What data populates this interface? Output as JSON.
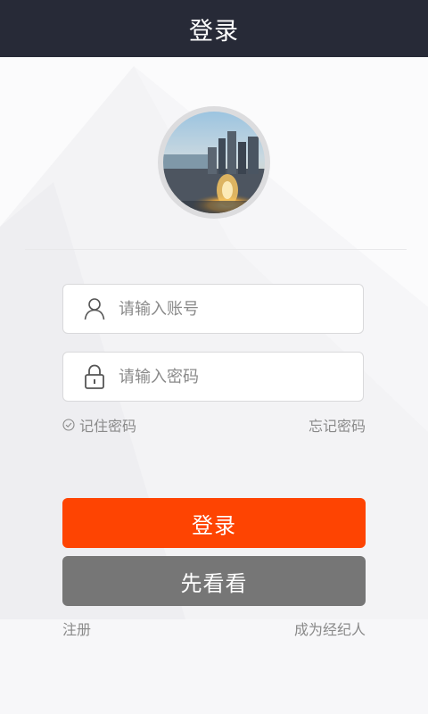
{
  "header": {
    "title": "登录"
  },
  "form": {
    "account_placeholder": "请输入账号",
    "password_placeholder": "请输入密码",
    "remember_label": "记住密码",
    "forgot_label": "忘记密码"
  },
  "buttons": {
    "login_label": "登录",
    "browse_label": "先看看"
  },
  "links": {
    "register_label": "注册",
    "agent_label": "成为经纪人"
  },
  "colors": {
    "titlebar": "#272a37",
    "login_button": "#fe4402",
    "browse_button": "#767676"
  },
  "icons": [
    "user-icon",
    "lock-icon",
    "check-circle-icon"
  ]
}
